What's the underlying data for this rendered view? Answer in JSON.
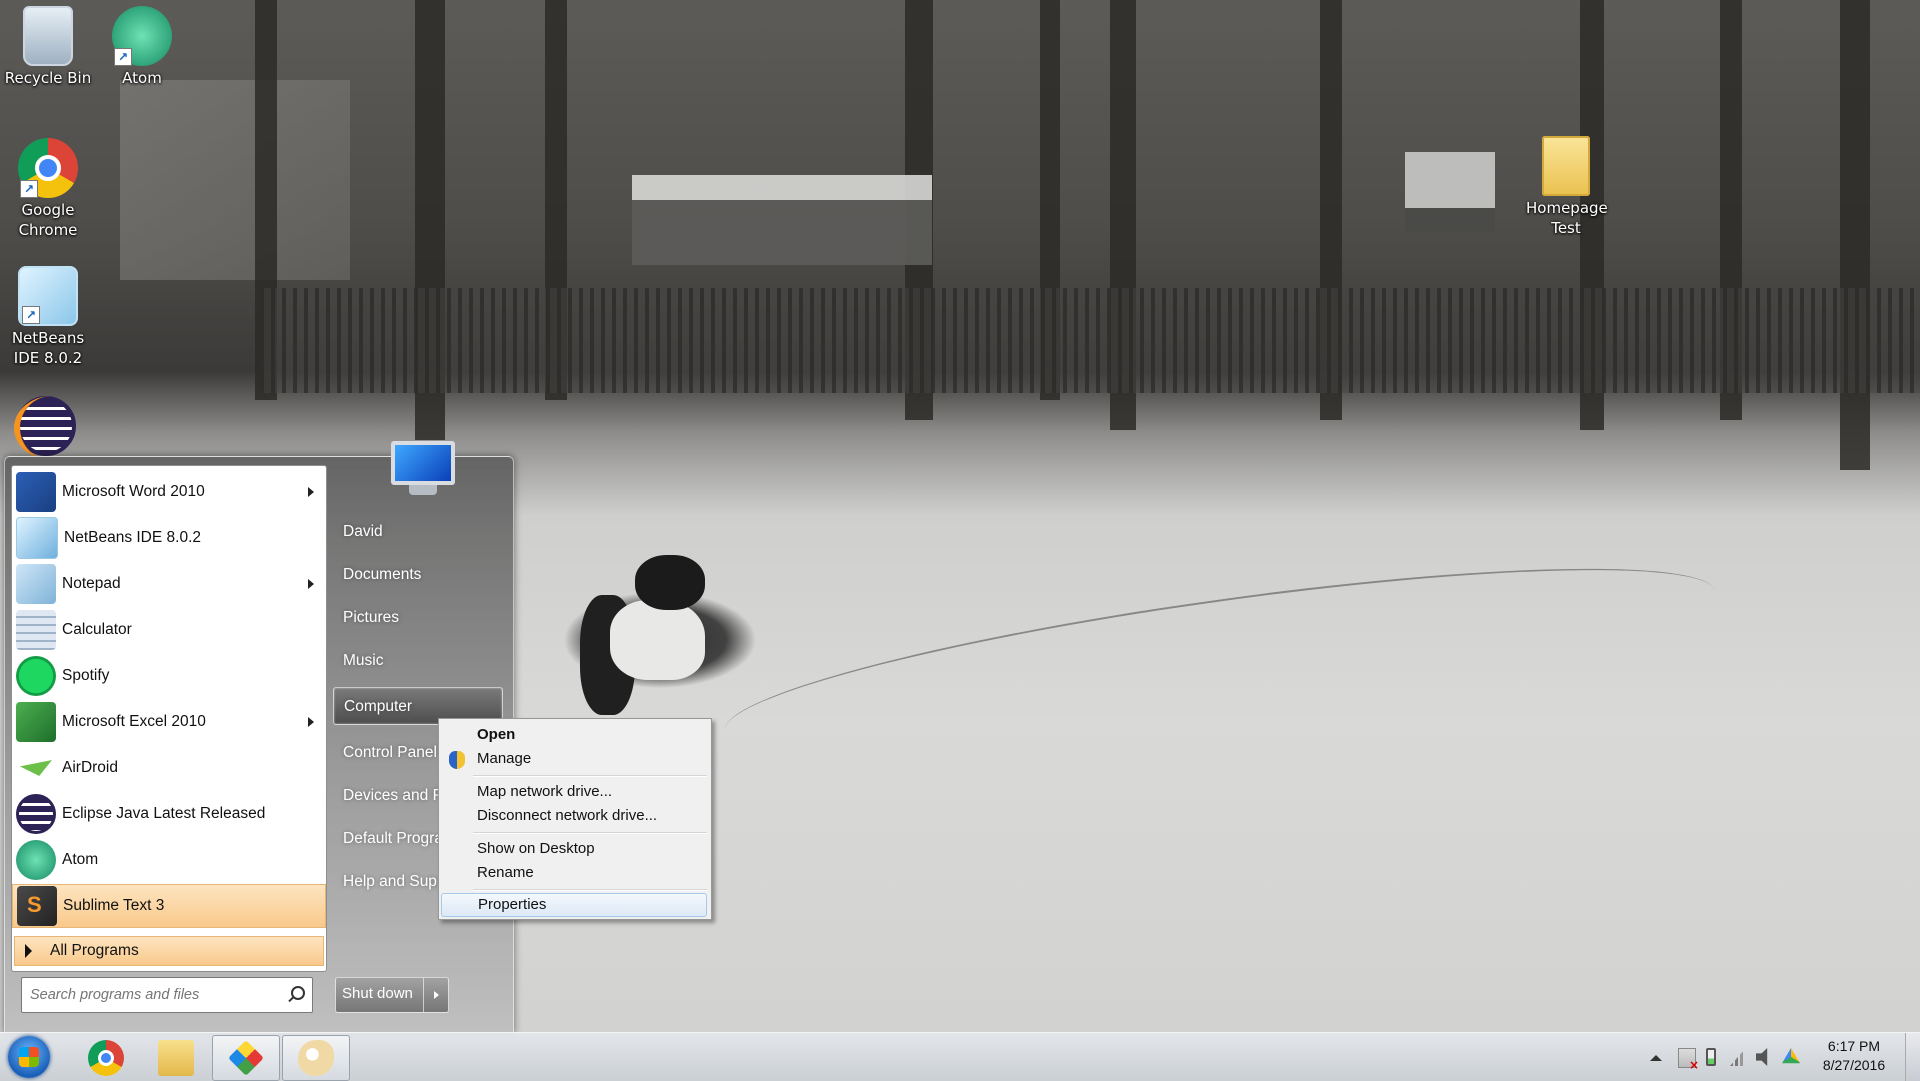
{
  "desktop": {
    "icons": [
      {
        "label": "Recycle Bin",
        "icon": "recycle-bin-icon"
      },
      {
        "label": "Atom",
        "icon": "atom-icon"
      },
      {
        "label": "Google Chrome",
        "icon": "chrome-icon"
      },
      {
        "label": "NetBeans IDE 8.0.2",
        "icon": "netbeans-icon"
      },
      {
        "label": "",
        "icon": "eclipse-icon"
      },
      {
        "label": "Homepage Test",
        "icon": "folder-icon"
      }
    ]
  },
  "start_menu": {
    "programs": [
      {
        "label": "Microsoft Word 2010",
        "icon": "word-icon",
        "submenu": true
      },
      {
        "label": "NetBeans IDE 8.0.2",
        "icon": "netbeans-icon",
        "submenu": false
      },
      {
        "label": "Notepad",
        "icon": "notepad-icon",
        "submenu": true
      },
      {
        "label": "Calculator",
        "icon": "calculator-icon",
        "submenu": false
      },
      {
        "label": "Spotify",
        "icon": "spotify-icon",
        "submenu": false
      },
      {
        "label": "Microsoft Excel 2010",
        "icon": "excel-icon",
        "submenu": true
      },
      {
        "label": "AirDroid",
        "icon": "airdroid-icon",
        "submenu": false
      },
      {
        "label": "Eclipse Java Latest Released",
        "icon": "eclipse-icon",
        "submenu": false
      },
      {
        "label": "Atom",
        "icon": "atom-icon",
        "submenu": false
      },
      {
        "label": "Sublime Text 3",
        "icon": "sublime-icon",
        "submenu": false,
        "highlighted": true
      }
    ],
    "all_programs": "All Programs",
    "search_placeholder": "Search programs and files",
    "right_links": [
      "David",
      "Documents",
      "Pictures",
      "Music",
      "Computer",
      "Control Panel",
      "Devices and Printers",
      "Default Programs",
      "Help and Support"
    ],
    "shutdown_label": "Shut down"
  },
  "context_menu": {
    "items": {
      "open": "Open",
      "manage": "Manage",
      "map_drive": "Map network drive...",
      "disconnect_drive": "Disconnect network drive...",
      "show_desktop": "Show on Desktop",
      "rename": "Rename",
      "properties": "Properties"
    }
  },
  "taskbar": {
    "pinned": [
      "windows-start-orb",
      "chrome-icon",
      "explorer-folder-icon",
      "colored-diamond-app-icon",
      "paint-icon"
    ],
    "clock": {
      "time": "6:17 PM",
      "date": "8/27/2016"
    }
  },
  "colors": {
    "start_highlight": "#f9c98b",
    "context_hover": "#dce9f6"
  }
}
